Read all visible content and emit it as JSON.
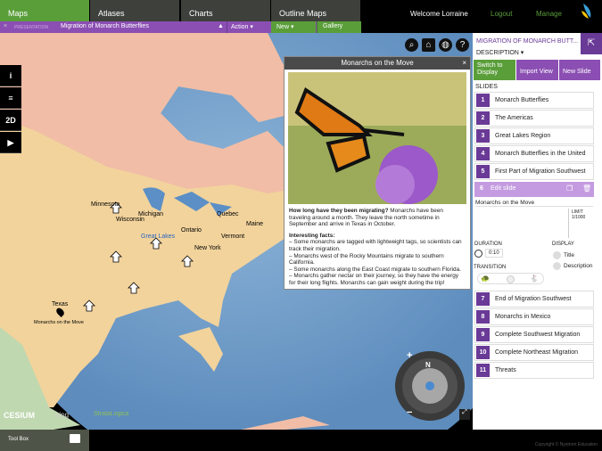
{
  "nav": {
    "tabs": [
      "Maps",
      "Atlases",
      "Charts",
      "Outline Maps"
    ],
    "welcome": "Welcome Lorraine",
    "logout": "Logout",
    "manage": "Manage"
  },
  "presentation": {
    "close": "×",
    "label": "PRESENTATION",
    "title": "Migration of Monarch Butterflies",
    "warning": "▲",
    "action": "Action ▾",
    "new": "New ▾",
    "gallery": "Gallery"
  },
  "map_tools": {
    "info": "i",
    "layers": "≡",
    "mode": "2D",
    "tour": "▶"
  },
  "map_labels": {
    "minnesota": "Minnesota",
    "wisconsin": "Wisconsin",
    "michigan": "Michigan",
    "great_lakes": "Great Lakes",
    "ontario": "Ontario",
    "quebec": "Quebec",
    "maine": "Maine",
    "vermont": "Vermont",
    "new_york": "New York",
    "texas": "Texas",
    "pin": "Monarchs on the Move"
  },
  "attribution": {
    "cesium": "CESIUM",
    "bing": "bing",
    "stratalogica": "StrataLogica"
  },
  "compass": {
    "north": "N",
    "zoom_in": "+",
    "zoom_out": "−"
  },
  "popup": {
    "title": "Monarchs on the Move",
    "close": "×",
    "question": "How long have they been migrating?",
    "answer": "Monarchs have been traveling around a month. They leave the north sometime in September and arrive in Texas in October.",
    "facts_title": "Interesting facts:",
    "facts": [
      "Some monarchs are tagged with lightweight tags, so scientists can track their migration.",
      "Monarchs west of the Rocky Mountains migrate to southern California.",
      "Some monarchs along the East Coast migrate to southern Florida.",
      "Monarchs gather nectar on their journey, so they have the energy for their long flights. Monarchs can gain weight during the trip!"
    ]
  },
  "panel": {
    "title": "MIGRATION OF MONARCH BUTT...",
    "description": "DESCRIPTION ▾",
    "switch": "Switch to Display",
    "import": "Import View",
    "new_slide": "New Slide",
    "slides_label": "SLIDES",
    "slides_top": [
      {
        "n": "1",
        "t": "Monarch Butterflies"
      },
      {
        "n": "2",
        "t": "The Americas"
      },
      {
        "n": "3",
        "t": "Great Lakes Region"
      },
      {
        "n": "4",
        "t": "Monarch Butterflies in the United"
      },
      {
        "n": "5",
        "t": "First Part of Migration Southwest"
      }
    ],
    "edit": {
      "n": "6",
      "label": "Edit slide",
      "title_value": "Monarchs on the Move",
      "limit": "LIMIT",
      "limit_value": "1/1000",
      "duration_label": "DURATION",
      "duration": "0:10",
      "display_label": "DISPLAY",
      "display_title": "Title",
      "display_description": "Description",
      "transition_label": "TRANSITION"
    },
    "slides_bottom": [
      {
        "n": "7",
        "t": "End of Migration Southwest"
      },
      {
        "n": "8",
        "t": "Monarchs in Mexico"
      },
      {
        "n": "9",
        "t": "Complete Southwest Migration"
      },
      {
        "n": "10",
        "t": "Complete Northeast Migration"
      },
      {
        "n": "11",
        "t": "Threats"
      }
    ]
  },
  "footer": {
    "toolbox": "Tool Box",
    "copyright": "Copyright © Nystrom Education"
  },
  "colors": {
    "green": "#5a9e3a",
    "purple": "#8b4fb3",
    "dark_purple": "#6a3a97"
  }
}
